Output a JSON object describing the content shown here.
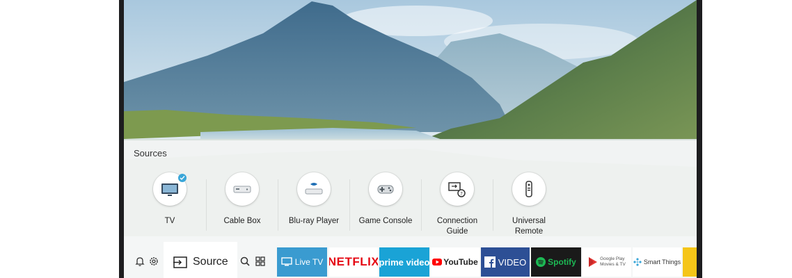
{
  "sources": {
    "title": "Sources",
    "items": [
      {
        "label": "TV",
        "icon": "tv-icon",
        "selected": true
      },
      {
        "label": "Cable Box",
        "icon": "cable-box-icon"
      },
      {
        "label": "Blu-ray Player",
        "icon": "blu-ray-player-icon"
      },
      {
        "label": "Game Console",
        "icon": "gamepad-icon"
      },
      {
        "label": "Connection\nGuide",
        "icon": "connection-guide-icon"
      },
      {
        "label": "Universal\nRemote",
        "icon": "remote-icon"
      }
    ]
  },
  "bottom_bar": {
    "left_icons": [
      "bell-icon",
      "gear-icon"
    ],
    "source_tab": {
      "label": "Source",
      "icon": "source-input-icon"
    },
    "right_icons": [
      "search-icon",
      "apps-grid-icon"
    ],
    "apps": [
      {
        "label": "Live TV",
        "bg": "#3a9bd0",
        "color": "#ffffff",
        "icon": "live-tv-icon"
      },
      {
        "label": "NETFLIX",
        "bg": "#ffffff",
        "color": "#e50914"
      },
      {
        "label": "prime video",
        "bg": "#1aa3d6",
        "color": "#ffffff"
      },
      {
        "label": "YouTube",
        "bg": "#ffffff",
        "color": "#222222",
        "icon": "youtube-icon"
      },
      {
        "label": "VIDEO",
        "bg": "#2d4f95",
        "color": "#ffffff",
        "icon": "facebook-icon"
      },
      {
        "label": "Spotify",
        "bg": "#1a1a1a",
        "color": "#1db954",
        "icon": "spotify-icon"
      },
      {
        "label": "Google Play\nMovies & TV",
        "bg": "#ffffff",
        "color": "#555555",
        "icon": "google-play-movies-icon"
      },
      {
        "label": "Smart Things",
        "bg": "#ffffff",
        "color": "#333333",
        "icon": "smartthings-icon"
      },
      {
        "label": "",
        "bg": "#f5c518",
        "color": "#ffffff",
        "icon": "partial-app-icon"
      }
    ]
  }
}
